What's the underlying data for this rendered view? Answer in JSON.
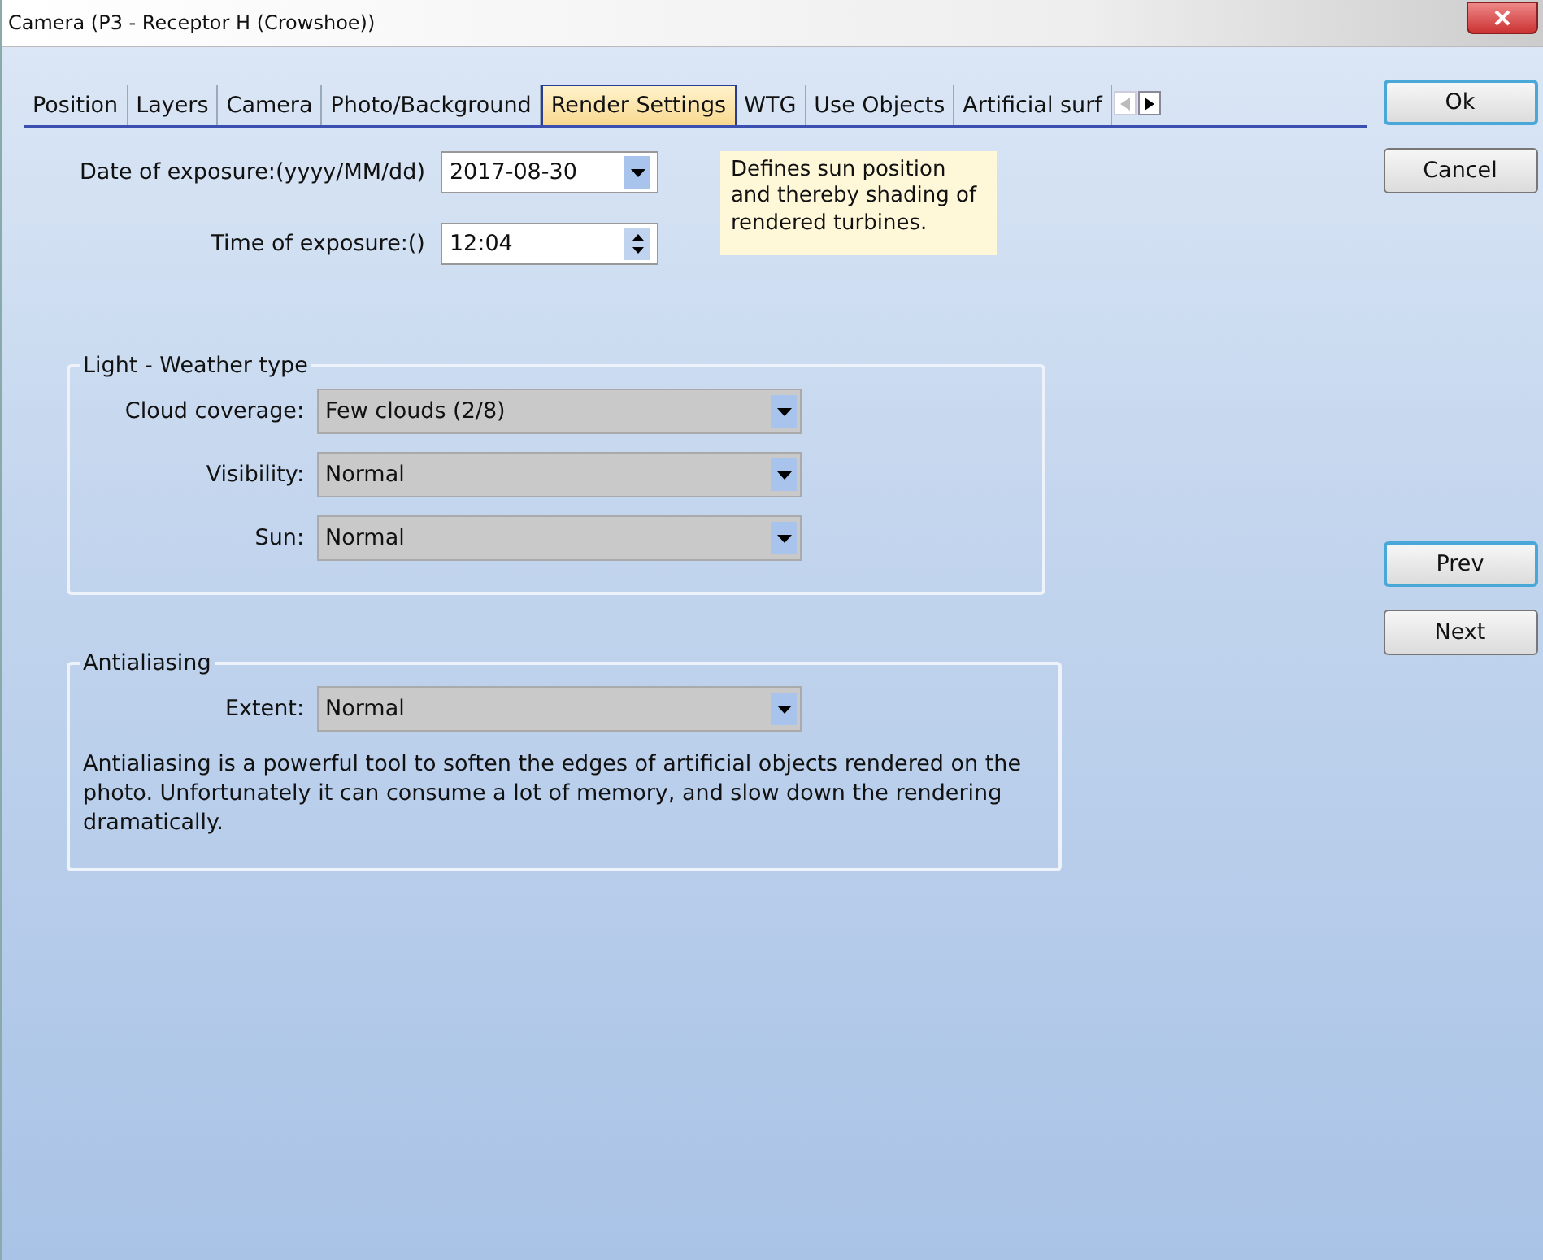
{
  "window": {
    "title": "Camera  (P3 - Receptor H (Crowshoe))"
  },
  "tabs": [
    {
      "label": "Position",
      "selected": false
    },
    {
      "label": "Layers",
      "selected": false
    },
    {
      "label": "Camera",
      "selected": false
    },
    {
      "label": "Photo/Background",
      "selected": false
    },
    {
      "label": "Render Settings",
      "selected": true
    },
    {
      "label": "WTG",
      "selected": false
    },
    {
      "label": "Use Objects",
      "selected": false
    },
    {
      "label": "Artificial surf",
      "selected": false
    }
  ],
  "exposure": {
    "date_label": "Date of exposure:(yyyy/MM/dd)",
    "date_value": "2017-08-30",
    "time_label": "Time of exposure:()",
    "time_value": "12:04",
    "hint": "Defines sun position and thereby shading of rendered turbines."
  },
  "weather": {
    "title": "Light - Weather type",
    "fields": [
      {
        "label": "Cloud coverage:",
        "value": "Few clouds (2/8)"
      },
      {
        "label": "Visibility:",
        "value": "Normal"
      },
      {
        "label": "Sun:",
        "value": "Normal"
      }
    ]
  },
  "antialiasing": {
    "title": "Antialiasing",
    "fields": [
      {
        "label": "Extent:",
        "value": "Normal"
      }
    ],
    "description": "Antialiasing is a powerful tool  to soften the edges of artificial objects rendered on the photo. Unfortunately it can consume a lot of memory, and slow down the rendering dramatically."
  },
  "buttons_top": [
    {
      "label": "Ok",
      "focused": true
    },
    {
      "label": "Cancel",
      "focused": false
    }
  ],
  "buttons_nav": [
    {
      "label": "Prev",
      "focused": true
    },
    {
      "label": "Next",
      "focused": false
    }
  ]
}
